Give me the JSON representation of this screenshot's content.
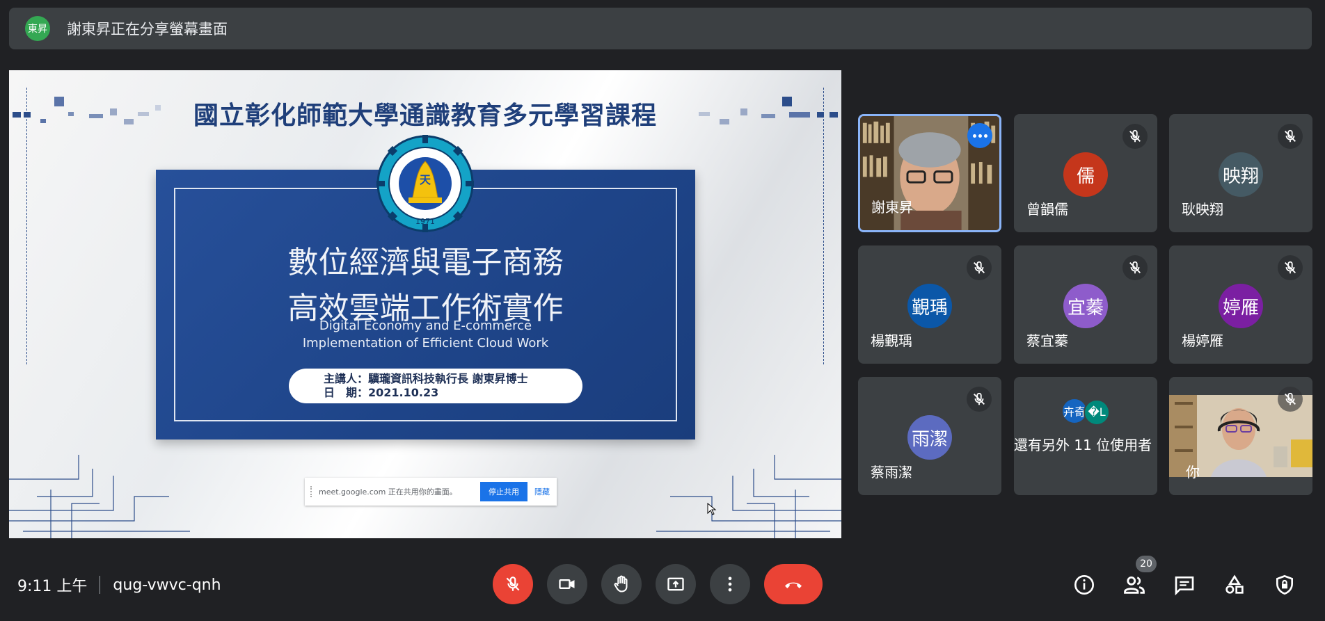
{
  "presentation_banner": {
    "avatar_text": "東昇",
    "text": "謝東昇正在分享螢幕畫面"
  },
  "slide": {
    "university_title": "國立彰化師範大學通識教育多元學習課程",
    "title_line1": "數位經濟與電子商務",
    "title_line2": "高效雲端工作術實作",
    "subtitle_line1": "Digital Economy and E-commerce",
    "subtitle_line2": "Implementation of Efficient Cloud Work",
    "speaker_line": "主講人：驥瓏資訊科技執行長 謝東昇博士",
    "date_line": "日　期：2021.10.23",
    "emblem_year": "1971"
  },
  "share_notice": {
    "text": "meet.google.com 正在共用你的畫面。",
    "stop_label": "停止共用",
    "hide_label": "隱藏"
  },
  "participants": [
    {
      "name": "謝東昇",
      "type": "video",
      "active": true
    },
    {
      "name": "曾韻儒",
      "avatar": "儒",
      "color": "#c5361b"
    },
    {
      "name": "耿映翔",
      "avatar": "映翔",
      "color": "#455a64"
    },
    {
      "name": "楊覲瑀",
      "avatar": "覲瑀",
      "color": "#0b57a8"
    },
    {
      "name": "蔡宜蓁",
      "avatar": "宜蓁",
      "color": "#8e5ccb"
    },
    {
      "name": "楊婷雁",
      "avatar": "婷雁",
      "color": "#7b1fa2"
    },
    {
      "name": "蔡雨潔",
      "avatar": "雨潔",
      "color": "#5c6bc0"
    },
    {
      "name": "你",
      "type": "video"
    }
  ],
  "others_tile": {
    "avatar1": "卉奇",
    "avatar1_color": "#1565c0",
    "avatar2": "�L",
    "avatar2_color": "#00897b",
    "label": "還有另外 11 位使用者"
  },
  "meeting": {
    "time": "9:11 上午",
    "code": "qug-vwvc-qnh",
    "participant_count": "20"
  },
  "controls": [
    "mic-off",
    "camera",
    "raise-hand",
    "present",
    "more",
    "end-call"
  ],
  "right_controls": [
    "info",
    "people",
    "chat",
    "activities",
    "host-controls"
  ]
}
